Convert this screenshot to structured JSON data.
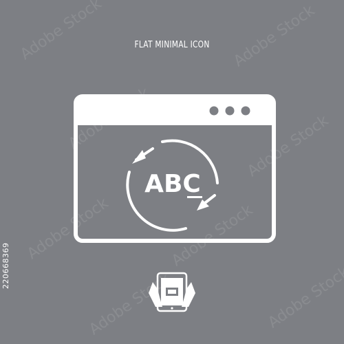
{
  "caption": "FLAT MINIMAL ICON",
  "icon_text": "ABC",
  "stock_id": "220668369",
  "watermark_text": "Adobe Stock",
  "colors": {
    "background": "#7d7f84",
    "foreground": "#ffffff"
  },
  "icons": [
    "browser-window-icon",
    "refresh-arrows-icon",
    "tablet-hands-icon"
  ]
}
